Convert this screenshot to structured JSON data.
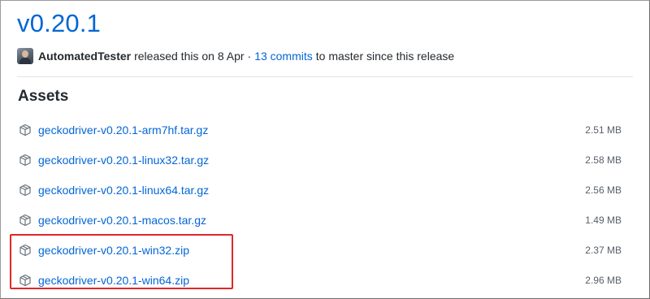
{
  "release": {
    "title": "v0.20.1",
    "author": "AutomatedTester",
    "released_text": "released this on 8 Apr",
    "separator": "·",
    "commits_link": "13 commits",
    "commits_suffix": "to master since this release"
  },
  "assets": {
    "heading": "Assets",
    "items": [
      {
        "name": "geckodriver-v0.20.1-arm7hf.tar.gz",
        "size": "2.51 MB"
      },
      {
        "name": "geckodriver-v0.20.1-linux32.tar.gz",
        "size": "2.58 MB"
      },
      {
        "name": "geckodriver-v0.20.1-linux64.tar.gz",
        "size": "2.56 MB"
      },
      {
        "name": "geckodriver-v0.20.1-macos.tar.gz",
        "size": "1.49 MB"
      },
      {
        "name": "geckodriver-v0.20.1-win32.zip",
        "size": "2.37 MB"
      },
      {
        "name": "geckodriver-v0.20.1-win64.zip",
        "size": "2.96 MB"
      }
    ]
  },
  "icons": {
    "asset": "package-icon",
    "avatar": "avatar-image"
  },
  "colors": {
    "link": "#0366d6",
    "text": "#24292e",
    "muted": "#586069",
    "highlight": "#e0262a"
  }
}
